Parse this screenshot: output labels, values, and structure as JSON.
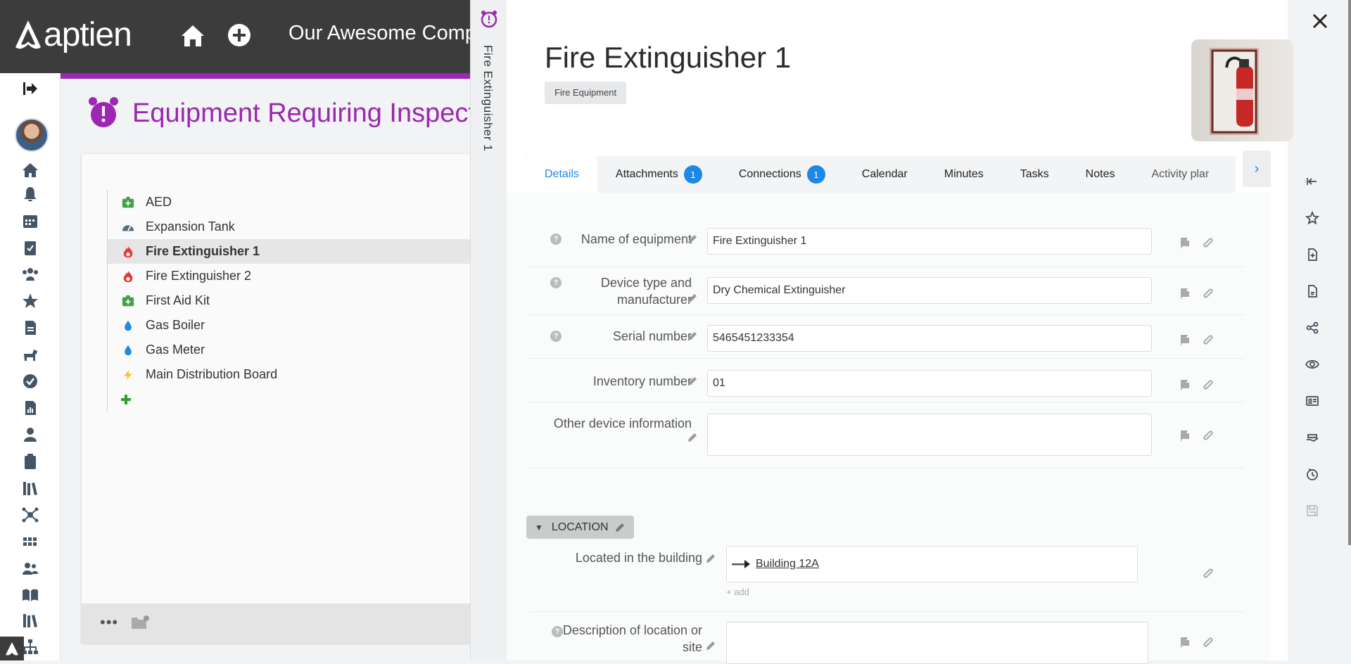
{
  "app": {
    "brand": "aptien",
    "company": "Our Awesome Comp"
  },
  "page": {
    "heading": "Equipment Requiring Inspectio"
  },
  "list": {
    "items": [
      {
        "label": "AED",
        "icon": "first-aid-icon",
        "color": "#43a047"
      },
      {
        "label": "Expansion Tank",
        "icon": "gauge-icon",
        "color": "#546e7a"
      },
      {
        "label": "Fire Extinguisher 1",
        "icon": "flame-icon",
        "color": "#e53935",
        "selected": true
      },
      {
        "label": "Fire Extinguisher 2",
        "icon": "flame-icon",
        "color": "#e53935"
      },
      {
        "label": "First Aid Kit",
        "icon": "first-aid-icon",
        "color": "#43a047"
      },
      {
        "label": "Gas Boiler",
        "icon": "drop-icon",
        "color": "#1e88e5"
      },
      {
        "label": "Gas Meter",
        "icon": "drop-icon",
        "color": "#1e88e5"
      },
      {
        "label": "Main Distribution Board",
        "icon": "bolt-icon",
        "color": "#fbc02d"
      }
    ],
    "footer_more": "•••"
  },
  "detail": {
    "vertical_title": "Fire Extinguisher 1",
    "title": "Fire Extinguisher 1",
    "tag": "Fire Equipment",
    "tabs": [
      {
        "label": "Details",
        "active": true
      },
      {
        "label": "Attachments",
        "badge": "1"
      },
      {
        "label": "Connections",
        "badge": "1"
      },
      {
        "label": "Calendar"
      },
      {
        "label": "Minutes"
      },
      {
        "label": "Tasks"
      },
      {
        "label": "Notes"
      },
      {
        "label": "Activity plans"
      }
    ],
    "fields": [
      {
        "label": "Name of equipment",
        "value": "Fire Extinguisher 1"
      },
      {
        "label": "Device type and manufacturer",
        "value": "Dry Chemical Extinguisher"
      },
      {
        "label": "Serial number",
        "value": "5465451233354"
      },
      {
        "label": "Inventory number",
        "value": "01"
      },
      {
        "label": "Other device information",
        "value": ""
      }
    ],
    "location": {
      "section_title": "LOCATION",
      "building_label": "Located in the building",
      "building_value": "Building 12A",
      "add_label": "+ add",
      "description_label": "Description of location or site",
      "description_value": ""
    }
  },
  "colors": {
    "accent": "#9c27b0",
    "link": "#1e88e5",
    "topbar": "#3c3c3c"
  }
}
